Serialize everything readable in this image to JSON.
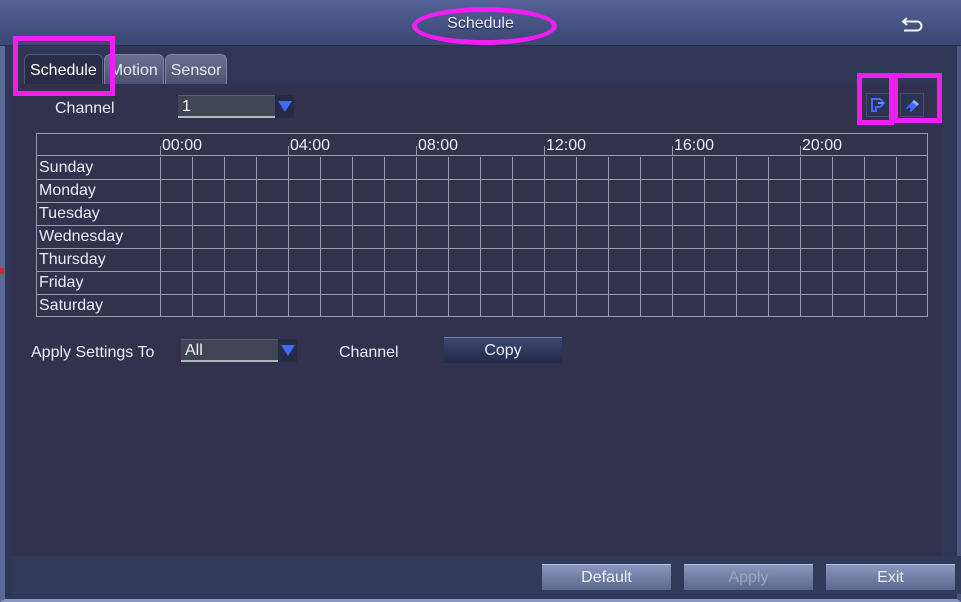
{
  "window": {
    "title": "Schedule",
    "back_icon": "return-arrow-icon"
  },
  "tabs": [
    {
      "label": "Schedule",
      "active": true
    },
    {
      "label": "Motion",
      "active": false
    },
    {
      "label": "Sensor",
      "active": false
    }
  ],
  "channel": {
    "label": "Channel",
    "value": "1"
  },
  "tools": {
    "edit_icon": "pencil-icon",
    "erase_icon": "eraser-icon"
  },
  "schedule_grid": {
    "hour_labels": [
      "00:00",
      "04:00",
      "08:00",
      "12:00",
      "16:00",
      "20:00"
    ],
    "hours_per_day": 24,
    "days": [
      "Sunday",
      "Monday",
      "Tuesday",
      "Wednesday",
      "Thursday",
      "Friday",
      "Saturday"
    ]
  },
  "apply_settings": {
    "label": "Apply Settings To",
    "value": "All",
    "channel_label": "Channel",
    "copy_label": "Copy"
  },
  "footer": {
    "default_label": "Default",
    "apply_label": "Apply",
    "apply_enabled": false,
    "exit_label": "Exit"
  },
  "colors": {
    "annotation": "#f21ef0",
    "dropdown_arrow": "#3f6cff"
  }
}
